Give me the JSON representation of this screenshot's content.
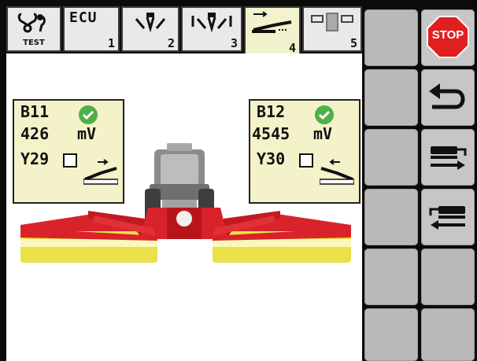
{
  "tabs": [
    {
      "id": "test",
      "label": "TEST",
      "icon": "diagnostic-icon",
      "number": ""
    },
    {
      "id": "ecu",
      "label": "ECU",
      "icon": "",
      "number": "1"
    },
    {
      "id": "tab2",
      "label": "",
      "icon": "mower-group-icon",
      "number": "2"
    },
    {
      "id": "tab3",
      "label": "",
      "icon": "mower-lift-icon",
      "number": "3"
    },
    {
      "id": "tab4",
      "label": "",
      "icon": "side-mower-icon",
      "number": "4",
      "active": true
    },
    {
      "id": "tab5",
      "label": "",
      "icon": "cab-display-icon",
      "number": "5"
    }
  ],
  "left_sensor": {
    "sensor": "B11",
    "value": "426",
    "unit": "mV",
    "status": "ok",
    "valve": "Y29",
    "valve_checked": false
  },
  "right_sensor": {
    "sensor": "B12",
    "value": "4545",
    "unit": "mV",
    "status": "ok",
    "valve": "Y30",
    "valve_checked": false
  },
  "softkeys": [
    {
      "name": "stop-button",
      "label": "STOP",
      "icon": "stop-sign-icon"
    },
    {
      "name": "back-button",
      "label": "",
      "icon": "return-arrow-icon"
    },
    {
      "name": "mower-out-button",
      "label": "",
      "icon": "mower-arrow-right-icon"
    },
    {
      "name": "mower-in-button",
      "label": "",
      "icon": "mower-arrow-left-icon"
    }
  ],
  "colors": {
    "panel": "#f3f2c9",
    "active_tab": "#f2f2cc",
    "mower_red": "#d8232a",
    "mower_yellow": "#e9e04a",
    "ok_green": "#4fb04a",
    "stop_red": "#e02020"
  }
}
